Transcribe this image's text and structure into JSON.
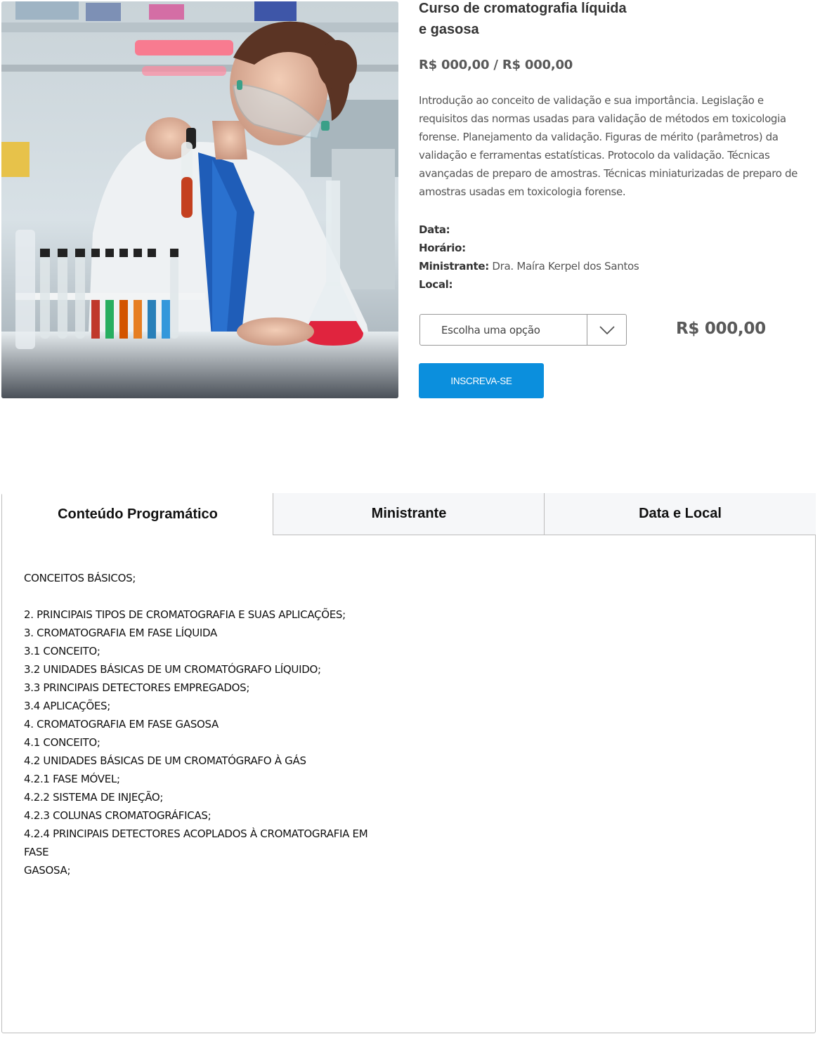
{
  "product": {
    "title_line1": "Curso de cromatografia líquida",
    "title_line2": "e gasosa",
    "price_range": "R$ 000,00 / R$ 000,00",
    "description": "Introdução ao conceito de validação e sua importância. Legislação e requisitos das normas usadas para validação de métodos em toxicologia forense. Planejamento da validação. Figuras de mérito (parâmetros) da validação e ferramentas estatísticas. Protocolo da validação. Técnicas avançadas de preparo de amostras. Técnicas miniaturizadas de preparo de amostras usadas em toxicologia forense.",
    "meta": {
      "date_label": "Data:",
      "date_value": "",
      "time_label": "Horário:",
      "time_value": "",
      "instructor_label": "Ministrante:",
      "instructor_value": "Dra. Maíra Kerpel dos Santos",
      "location_label": "Local:",
      "location_value": ""
    },
    "variant_select": {
      "selected": "Escolha uma opção",
      "icon": "chevron-down-icon"
    },
    "variant_price": "R$ 000,00",
    "subscribe_label": "INSCREVA-SE",
    "accent_color": "#0b8fdd"
  },
  "tabs": [
    {
      "label": "Conteúdo Programático",
      "active": true
    },
    {
      "label": "Ministrante",
      "active": false
    },
    {
      "label": "Data e Local",
      "active": false
    }
  ],
  "tab_content": {
    "lines": [
      "CONCEITOS BÁSICOS;",
      "",
      "2. PRINCIPAIS TIPOS DE CROMATOGRAFIA E SUAS APLICAÇÕES;",
      "3. CROMATOGRAFIA EM FASE LÍQUIDA",
      "3.1 CONCEITO;",
      "3.2 UNIDADES BÁSICAS DE UM CROMATÓGRAFO LÍQUIDO;",
      "3.3 PRINCIPAIS DETECTORES EMPREGADOS;",
      "3.4 APLICAÇÕES;",
      "4. CROMATOGRAFIA EM FASE GASOSA",
      "4.1 CONCEITO;",
      "4.2 UNIDADES BÁSICAS DE UM CROMATÓGRAFO À GÁS",
      "4.2.1 FASE MÓVEL;",
      "4.2.2 SISTEMA DE INJEÇÃO;",
      "4.2.3 COLUNAS CROMATOGRÁFICAS;",
      "4.2.4 PRINCIPAIS DETECTORES ACOPLADOS À CROMATOGRAFIA EM",
      "FASE",
      "GASOSA;"
    ]
  }
}
